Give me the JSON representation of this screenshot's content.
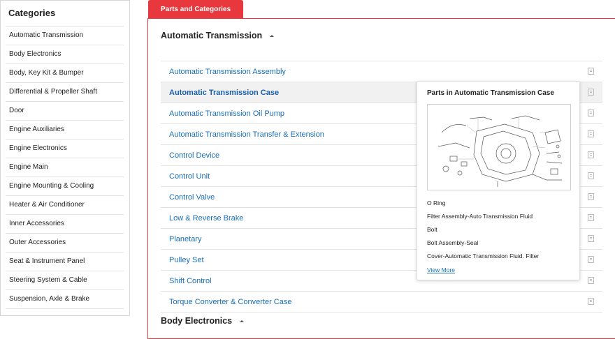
{
  "sidebar": {
    "title": "Categories",
    "items": [
      "Automatic Transmission",
      "Body Electronics",
      "Body, Key Kit & Bumper",
      "Differential & Propeller Shaft",
      "Door",
      "Engine Auxiliaries",
      "Engine Electronics",
      "Engine Main",
      "Engine Mounting & Cooling",
      "Heater & Air Conditioner",
      "Inner Accessories",
      "Outer Accessories",
      "Seat & Instrument Panel",
      "Steering System & Cable",
      "Suspension, Axle & Brake"
    ]
  },
  "main": {
    "tab_label": "Parts and Categories",
    "sections": [
      {
        "title": "Automatic Transmission",
        "items": [
          "Automatic Transmission Assembly",
          "Automatic Transmission Case",
          "Automatic Transmission Oil Pump",
          "Automatic Transmission Transfer & Extension",
          "Control Device",
          "Control Unit",
          "Control Valve",
          "Low & Reverse Brake",
          "Planetary",
          "Pulley Set",
          "Shift Control",
          "Torque Converter & Converter Case"
        ],
        "active_index": 1
      },
      {
        "title": "Body Electronics"
      }
    ]
  },
  "popover": {
    "title": "Parts in Automatic Transmission Case",
    "parts": [
      "O Ring",
      "Filter Assembly-Auto Transmission Fluid",
      "Bolt",
      "Bolt Assembly-Seal",
      "Cover-Automatic Transmission Fluid. Filter"
    ],
    "view_more": "View More"
  },
  "colors": {
    "accent": "#e8383d",
    "link": "#1a6eb5"
  }
}
